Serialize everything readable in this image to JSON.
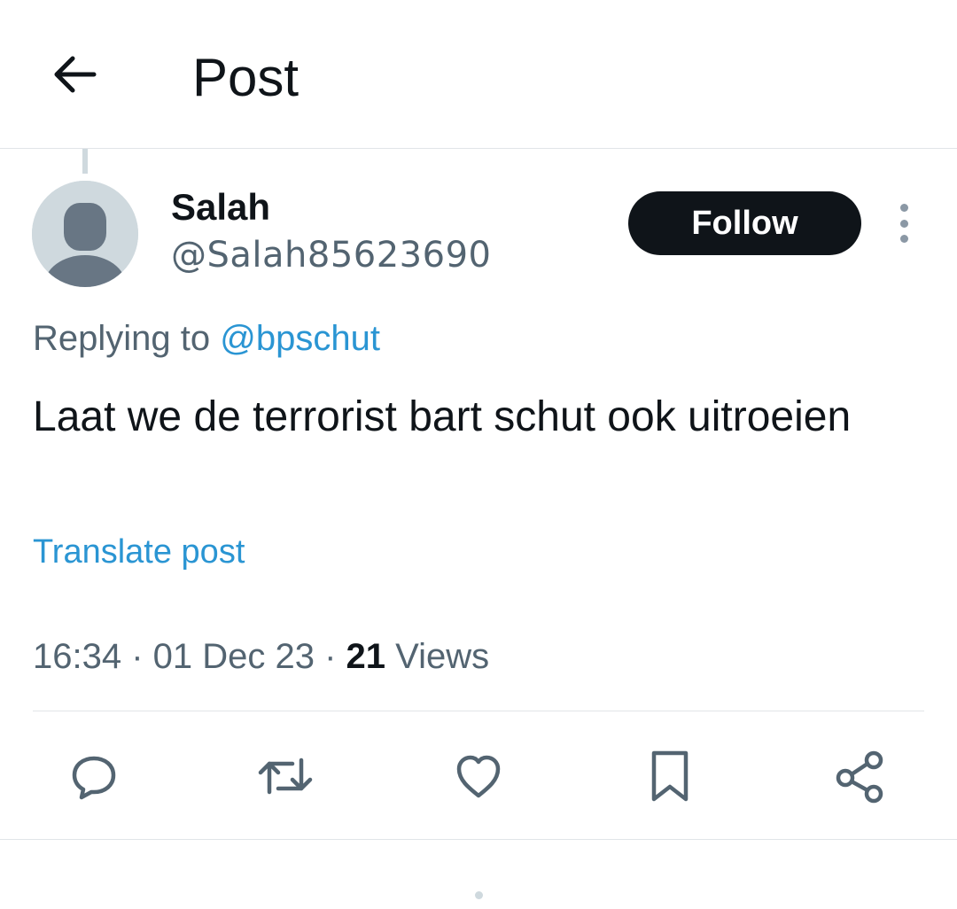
{
  "header": {
    "title": "Post",
    "back_icon": "arrow-left-icon"
  },
  "author": {
    "name": "Salah",
    "handle": "@Salah85623690",
    "avatar_icon": "default-avatar-icon"
  },
  "follow_label": "Follow",
  "more_icon": "more-vertical-icon",
  "reply": {
    "prefix": "Replying to ",
    "mention": "@bpschut"
  },
  "post": {
    "text": "Laat we de terrorist bart schut ook uitroeien",
    "translate_label": "Translate post"
  },
  "meta": {
    "time": "16:34",
    "separator": " · ",
    "date": "01 Dec 23",
    "views_count": "21",
    "views_label": " Views"
  },
  "actions": [
    {
      "icon": "comment-icon"
    },
    {
      "icon": "repost-icon"
    },
    {
      "icon": "like-icon"
    },
    {
      "icon": "bookmark-icon"
    },
    {
      "icon": "share-icon"
    }
  ],
  "colors": {
    "text_primary": "#0f1419",
    "text_secondary": "#536471",
    "link": "#2a95d3",
    "follow_bg": "#0f1419",
    "divider": "#e1e5e8"
  }
}
